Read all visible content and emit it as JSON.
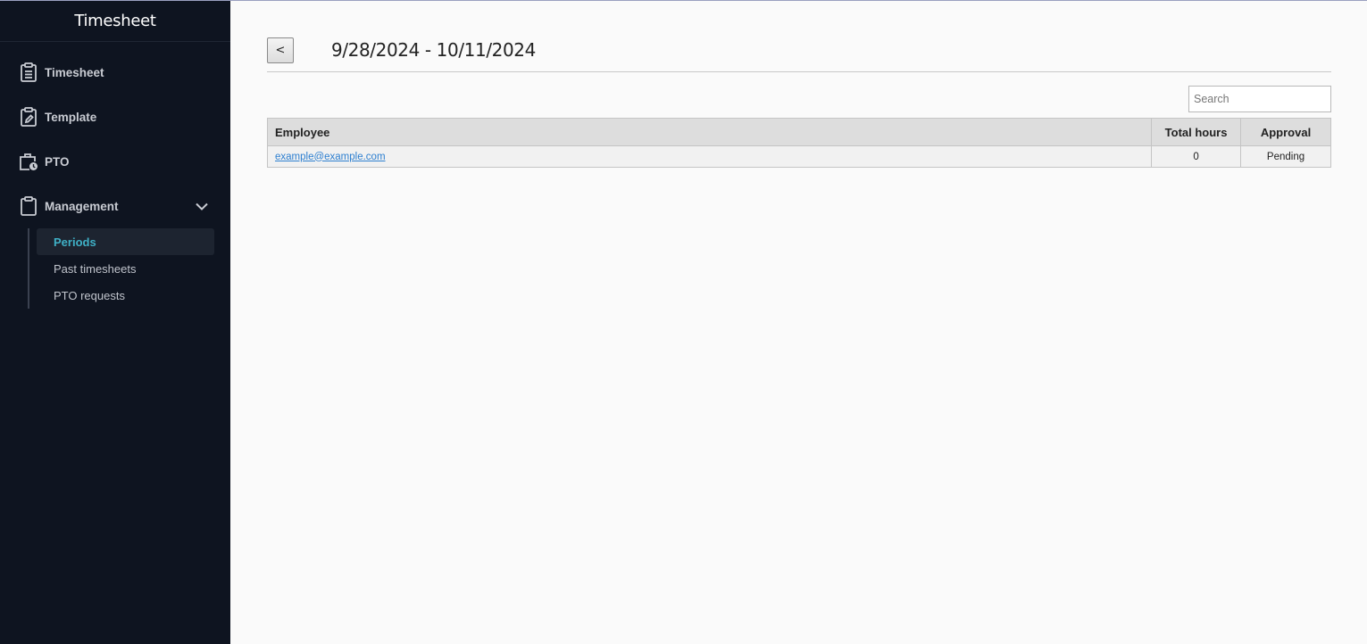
{
  "sidebar": {
    "title": "Timesheet",
    "items": [
      {
        "label": "Timesheet",
        "icon": "clipboard-list-icon"
      },
      {
        "label": "Template",
        "icon": "clipboard-edit-icon"
      },
      {
        "label": "PTO",
        "icon": "briefcase-clock-icon"
      },
      {
        "label": "Management",
        "icon": "clipboard-icon",
        "expanded": true
      }
    ],
    "subitems": [
      {
        "label": "Periods",
        "active": true
      },
      {
        "label": "Past timesheets",
        "active": false
      },
      {
        "label": "PTO requests",
        "active": false
      }
    ]
  },
  "main": {
    "back_label": "<",
    "period_title": "9/28/2024 - 10/11/2024",
    "search": {
      "placeholder": "Search",
      "value": ""
    },
    "table": {
      "headers": [
        "Employee",
        "Total hours",
        "Approval"
      ],
      "rows": [
        {
          "employee": "example@example.com",
          "total_hours": "0",
          "approval": "Pending"
        }
      ]
    }
  },
  "colors": {
    "sidebar_bg": "#0e1420",
    "accent": "#3fb0c6",
    "link": "#2d7fd0",
    "header_bg": "#dddddd"
  }
}
